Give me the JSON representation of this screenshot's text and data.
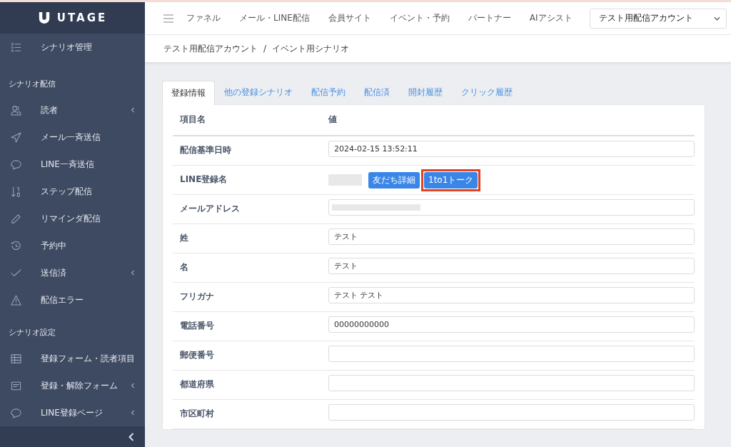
{
  "brand": {
    "name": "UTAGE"
  },
  "sidebar": {
    "top_item": {
      "label": "シナリオ管理",
      "kind": "list"
    },
    "sections": [
      {
        "title": "シナリオ配信",
        "items": [
          {
            "label": "読者",
            "kind": "users",
            "has_submenu": true
          },
          {
            "label": "メール一斉送信",
            "kind": "send",
            "has_submenu": false
          },
          {
            "label": "LINE一斉送信",
            "kind": "chat",
            "has_submenu": false
          },
          {
            "label": "ステップ配信",
            "kind": "sort",
            "has_submenu": false
          },
          {
            "label": "リマインダ配信",
            "kind": "pencil",
            "has_submenu": false
          },
          {
            "label": "予約中",
            "kind": "clock",
            "has_submenu": false
          },
          {
            "label": "送信済",
            "kind": "check",
            "has_submenu": true
          },
          {
            "label": "配信エラー",
            "kind": "warning",
            "has_submenu": false
          }
        ]
      },
      {
        "title": "シナリオ設定",
        "items": [
          {
            "label": "登録フォーム・読者項目",
            "kind": "table",
            "has_submenu": false
          },
          {
            "label": "登録・解除フォーム",
            "kind": "form",
            "has_submenu": true
          },
          {
            "label": "LINE登録ページ",
            "kind": "chat",
            "has_submenu": true
          }
        ]
      }
    ]
  },
  "top_nav": {
    "items": [
      "ファネル",
      "メール・LINE配信",
      "会員サイト",
      "イベント・予約",
      "パートナー",
      "AIアシスト"
    ],
    "account_select": "テスト用配信アカウント"
  },
  "breadcrumb": {
    "items": [
      "テスト用配信アカウント",
      "イベント用シナリオ"
    ],
    "separator": "/"
  },
  "tabs": [
    {
      "label": "登録情報",
      "selected": true
    },
    {
      "label": "他の登録シナリオ",
      "selected": false
    },
    {
      "label": "配信予約",
      "selected": false
    },
    {
      "label": "配信済",
      "selected": false
    },
    {
      "label": "開封履歴",
      "selected": false
    },
    {
      "label": "クリック履歴",
      "selected": false
    }
  ],
  "table": {
    "columns": [
      "項目名",
      "値"
    ],
    "rows": [
      {
        "label": "配信基準日時",
        "kind": "field",
        "value": "2024-02-15 13:52:11"
      },
      {
        "label": "LINE登録名",
        "kind": "buttons",
        "buttons": [
          {
            "label": "友だち詳細",
            "highlighted": false
          },
          {
            "label": "1to1トーク",
            "highlighted": true
          }
        ]
      },
      {
        "label": "メールアドレス",
        "kind": "masked"
      },
      {
        "label": "姓",
        "kind": "field",
        "value": "テスト"
      },
      {
        "label": "名",
        "kind": "field",
        "value": "テスト"
      },
      {
        "label": "フリガナ",
        "kind": "field",
        "value": "テスト テスト"
      },
      {
        "label": "電話番号",
        "kind": "field",
        "value": "00000000000"
      },
      {
        "label": "郵便番号",
        "kind": "field",
        "value": ""
      },
      {
        "label": "都道府県",
        "kind": "field",
        "value": ""
      },
      {
        "label": "市区町村",
        "kind": "field",
        "value": ""
      }
    ]
  }
}
